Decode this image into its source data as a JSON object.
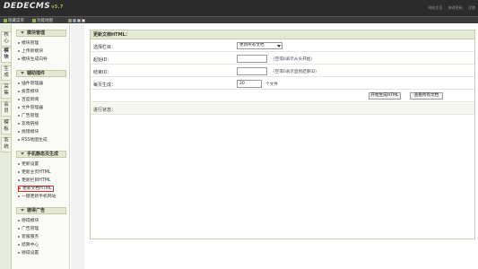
{
  "header": {
    "logo_text": "DEDECMS",
    "version": "v5.7",
    "links": [
      "网站主页",
      "修改密码",
      "注销"
    ],
    "nav": [
      "隐藏菜单",
      "功能地图"
    ],
    "swatch_colors": [
      "#8fb84a",
      "#7fb0d8",
      "#c8c8c8",
      "#e6e6e6"
    ]
  },
  "vtabs": [
    "核心",
    "模块",
    "生成",
    "采集",
    "会员",
    "模板",
    "系统"
  ],
  "menu": {
    "sections": [
      {
        "title": "模块管理",
        "items": [
          "模块管理",
          "上传新模块",
          "模块生成向导"
        ]
      },
      {
        "title": "辅助插件",
        "items": [
          "插件管理器",
          "投票模块",
          "百度新闻",
          "文件管理器",
          "广告管理",
          "友情链接",
          "挑错模块",
          "RSS地图生成"
        ]
      },
      {
        "title": "手机静态页生成",
        "items": [
          "更新设置",
          "更新主页HTML",
          "更新栏目HTML",
          "更新文档HTML",
          "一键更新手机网站"
        ]
      },
      {
        "title": "德得广告",
        "items": [
          "德得模块",
          "广告管理",
          "客服服务",
          "结算中心",
          "德得设置"
        ]
      }
    ]
  },
  "form": {
    "title": "更新文档HTML：",
    "category_label": "选择栏目：",
    "category_value": "更新所有文档",
    "start_label": "起始ID：",
    "start_hint": "（空或0表示从头开始）",
    "end_label": "结束ID：",
    "end_hint": "（空或0表示直到结束ID）",
    "perpage_label": "每页生成：",
    "perpage_value": "20",
    "perpage_unit": "个文件",
    "start_button": "开始生成HTML",
    "view_button": "查看所有文档",
    "status_label": "进行状态："
  }
}
